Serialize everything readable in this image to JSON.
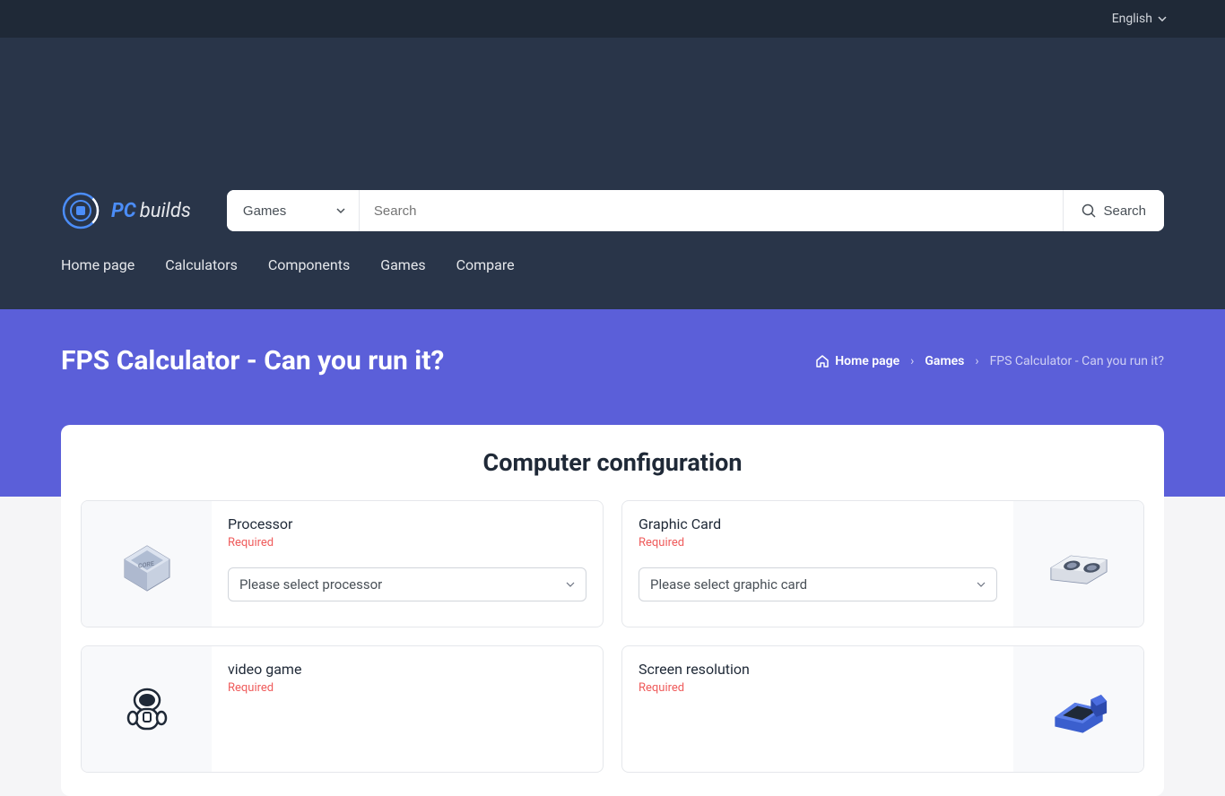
{
  "topbar": {
    "language": "English"
  },
  "logo": {
    "pc": "PC",
    "builds": "builds"
  },
  "search": {
    "category": "Games",
    "placeholder": "Search",
    "button": "Search"
  },
  "nav": {
    "items": [
      "Home page",
      "Calculators",
      "Components",
      "Games",
      "Compare"
    ]
  },
  "hero": {
    "title": "FPS Calculator - Can you run it?"
  },
  "breadcrumb": {
    "home": "Home page",
    "games": "Games",
    "current": "FPS Calculator - Can you run it?"
  },
  "config": {
    "section_title": "Computer configuration",
    "required_label": "Required",
    "processor": {
      "label": "Processor",
      "placeholder": "Please select processor"
    },
    "graphic_card": {
      "label": "Graphic Card",
      "placeholder": "Please select graphic card"
    },
    "video_game": {
      "label": "video game"
    },
    "screen_resolution": {
      "label": "Screen resolution"
    }
  }
}
